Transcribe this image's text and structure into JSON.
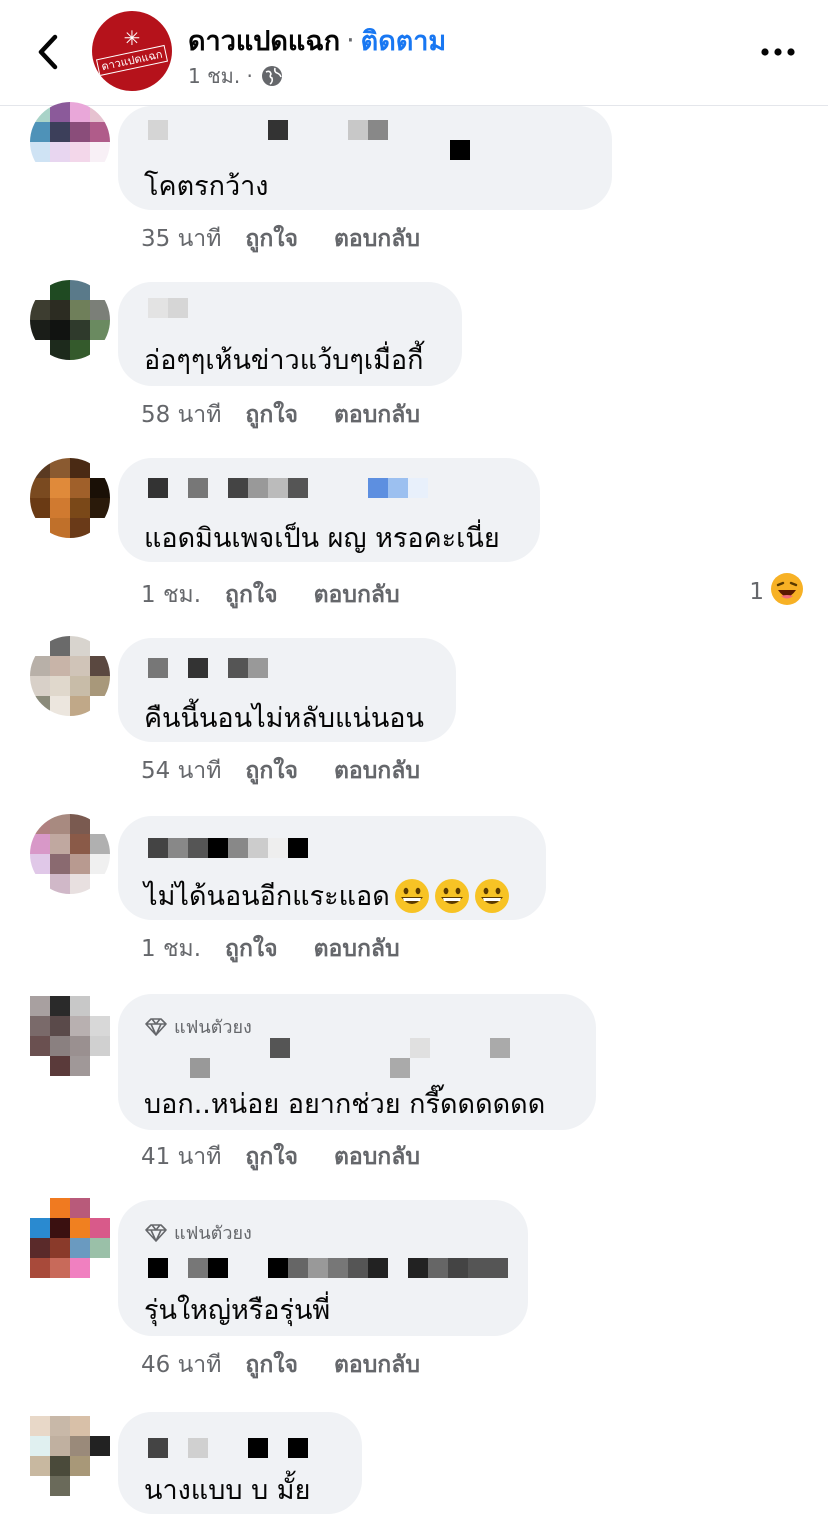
{
  "header": {
    "page_name": "ดาวแปดแฉก",
    "separator": "·",
    "follow_label": "ติดตาม",
    "time": "1 ชม. ·",
    "logo_text": "ดาวแปดแฉก"
  },
  "icons": {
    "back": "chevron-left-icon",
    "globe": "globe-icon",
    "more": "more-horizontal-icon",
    "diamond": "diamond-icon",
    "grin_emoji": "grinning-face-icon",
    "laugh_emoji": "laughing-face-icon"
  },
  "colors": {
    "brand_red": "#b5121b",
    "follow_blue": "#1877f2",
    "bubble_bg": "#f0f2f5",
    "meta_gray": "#65676b"
  },
  "comments": [
    {
      "text": "โคตรกว้าง",
      "time": "35 นาที",
      "like": "ถูกใจ",
      "reply": "ตอบกลับ"
    },
    {
      "text": "อ่อๆๆเห้นข่าวแว้บๆเมื่อกี้",
      "time": "58 นาที",
      "like": "ถูกใจ",
      "reply": "ตอบกลับ"
    },
    {
      "text": "แอดมินเพจเป็น ผญ หรอคะเนี่ย",
      "time": "1 ชม.",
      "like": "ถูกใจ",
      "reply": "ตอบกลับ",
      "reaction_count": "1"
    },
    {
      "text": "คืนนี้นอนไม่หลับแน่นอน",
      "time": "54 นาที",
      "like": "ถูกใจ",
      "reply": "ตอบกลับ"
    },
    {
      "text": "ไม่ได้นอนอีกแระแอด",
      "time": "1 ชม.",
      "like": "ถูกใจ",
      "reply": "ตอบกลับ"
    },
    {
      "badge": "แฟนตัวยง",
      "text": "บอก..หน่อย อยากช่วย กรี๊ดดดดดด",
      "time": "41 นาที",
      "like": "ถูกใจ",
      "reply": "ตอบกลับ"
    },
    {
      "badge": "แฟนตัวยง",
      "text": "รุ่นใหญ่หรือรุ่นพี่",
      "time": "46 นาที",
      "like": "ถูกใจ",
      "reply": "ตอบกลับ"
    },
    {
      "text": "นางแบบ บ มั้ย"
    }
  ]
}
